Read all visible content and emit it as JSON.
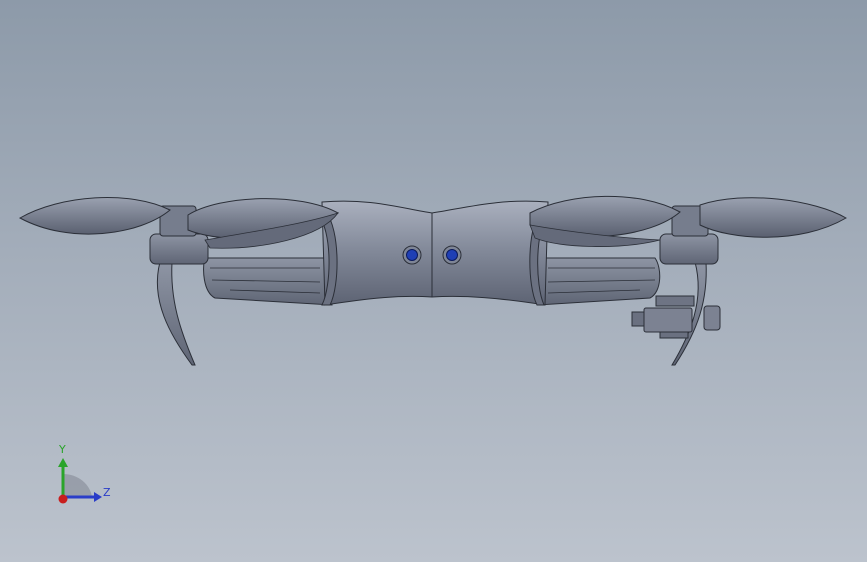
{
  "viewport": {
    "background_top": "#8d9aa9",
    "background_bottom": "#bcc3cd"
  },
  "model": {
    "body_color": "#7e8596",
    "body_light": "#a7adbb",
    "outline": "#2b2f38",
    "led_color": "#1f3fb5"
  },
  "triad": {
    "y_label": "Y",
    "z_label": "Z",
    "y_color": "#2aa42a",
    "z_color": "#2a3dc8",
    "x_color": "#c81e1e"
  }
}
